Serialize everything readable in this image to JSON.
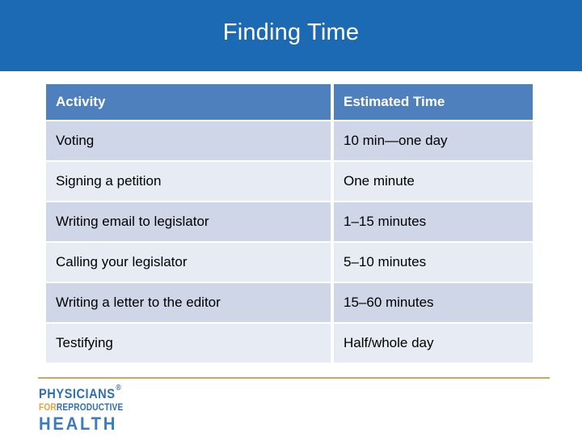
{
  "slide": {
    "title": "Finding Time",
    "banner_color": "#1d6ab4",
    "title_color": "#ffffff"
  },
  "table": {
    "header_color": "#4e80be",
    "row_dark_color": "#ced6e7",
    "row_light_color": "#e7ebf4",
    "columns": [
      "Activity",
      "Estimated Time"
    ],
    "rows": [
      {
        "activity": "Voting",
        "time": "10 min—one day"
      },
      {
        "activity": "Signing a petition",
        "time": "One minute"
      },
      {
        "activity": "Writing email to legislator",
        "time": "1–15 minutes"
      },
      {
        "activity": "Calling your legislator",
        "time": "5–10 minutes"
      },
      {
        "activity": "Writing a letter to the editor",
        "time": "15–60 minutes"
      },
      {
        "activity": "Testifying",
        "time": "Half/whole day"
      }
    ]
  },
  "footer": {
    "rule_color": "#c9a961",
    "logo": {
      "line1": "PHYSICIANS",
      "mark": "®",
      "line2_for": "FOR",
      "line2_reproductive": "REPRODUCTIVE",
      "line3": "HEALTH",
      "blue": "#2f6eb5",
      "orange": "#e8a33d"
    }
  }
}
